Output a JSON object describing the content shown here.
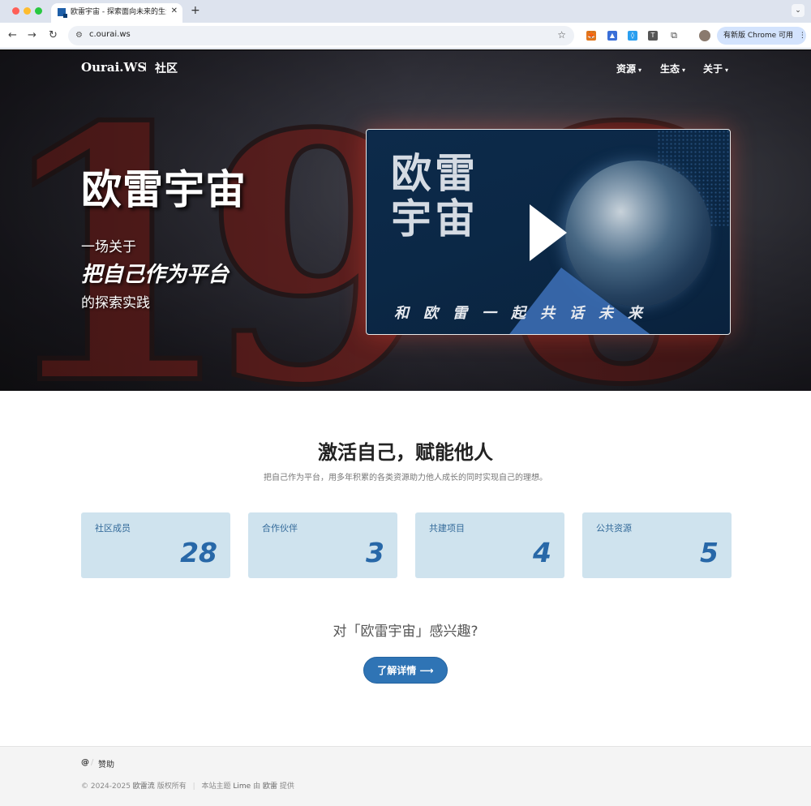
{
  "browser": {
    "tab_title": "欧雷宇宙 - 探索面向未来的生活",
    "tab_close": "✕",
    "new_tab": "+",
    "tab_menu": "⌄",
    "url": "c.ourai.ws",
    "back": "←",
    "forward": "→",
    "reload": "↻",
    "site_info": "⚙",
    "bookmark": "☆",
    "update_label": "有新版 Chrome 可用",
    "update_menu": "⋮",
    "ext_labels": [
      "🦊",
      "▲",
      "◊",
      "T",
      "⧉"
    ]
  },
  "header": {
    "brand": "Ourai.WS",
    "brand_sub": "社区",
    "nav": [
      {
        "label": "资源",
        "caret": "▾"
      },
      {
        "label": "生态",
        "caret": "▾"
      },
      {
        "label": "关于",
        "caret": "▾"
      }
    ]
  },
  "hero": {
    "title": "欧雷宇宙",
    "line1": "一场关于",
    "line2": "把自己作为平台",
    "line3": "的探索实践",
    "video": {
      "title": "欧雷宇宙",
      "slogan": "和欧雷一起共话未来"
    },
    "background_numbers": [
      "1",
      "9",
      "8"
    ]
  },
  "section": {
    "title": "激活自己，赋能他人",
    "subtitle": "把自己作为平台，用多年积累的各类资源助力他人成长的同时实现自己的理想。"
  },
  "stats": [
    {
      "label": "社区成员",
      "value": "28"
    },
    {
      "label": "合作伙伴",
      "value": "3"
    },
    {
      "label": "共建项目",
      "value": "4"
    },
    {
      "label": "公共资源",
      "value": "5"
    }
  ],
  "cta": {
    "question": "对「欧雷宇宙」感兴趣?",
    "button": "了解详情 ⟶"
  },
  "footer": {
    "at": "@",
    "slash": "/",
    "sponsor": "赞助",
    "copyright": "© 2024-2025",
    "owner": "欧雷流",
    "rights": "版权所有",
    "separator": "|",
    "theme_prefix": "本站主题",
    "theme": "Lime",
    "by": "由",
    "author": "欧雷",
    "provided": "提供"
  }
}
